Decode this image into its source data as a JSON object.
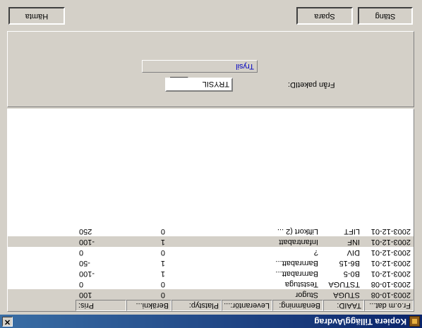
{
  "window": {
    "title": "Kopiera Tillägg\\Avdrag",
    "close_glyph": "✕"
  },
  "grid": {
    "columns": [
      {
        "label": "Fr.o.m dat...",
        "align": "left"
      },
      {
        "label": "TAAID:",
        "align": "left"
      },
      {
        "label": "Benämning:",
        "align": "left"
      },
      {
        "label": "Leverantör:...",
        "align": "left"
      },
      {
        "label": "Platstyp:",
        "align": "left"
      },
      {
        "label": "Beräkni...",
        "align": "left"
      },
      {
        "label": "Pris:",
        "align": "right"
      }
    ],
    "rows": [
      {
        "date": "2003-10-08",
        "id": "STUGA",
        "name": "Stugor",
        "calc": "0",
        "price": "100",
        "highlight": true
      },
      {
        "date": "2003-10-08",
        "id": "TSTUGA",
        "name": "Teststuga",
        "calc": "0",
        "price": "0",
        "highlight": false
      },
      {
        "date": "2003-12-01",
        "id": "B0-5",
        "name": "Barnrabatt...",
        "calc": "1",
        "price": "-100",
        "highlight": false
      },
      {
        "date": "2003-12-01",
        "id": "B6-15",
        "name": "Barnrabatt...",
        "calc": "1",
        "price": "-50",
        "highlight": false
      },
      {
        "date": "2003-12-01",
        "id": "DIV",
        "name": "?",
        "calc": "0",
        "price": "0",
        "highlight": false
      },
      {
        "date": "2003-12-01",
        "id": "INF",
        "name": "Infantrabatt",
        "calc": "1",
        "price": "-100",
        "highlight": true
      },
      {
        "date": "2003-12-01",
        "id": "LIFT",
        "name": "Liftkort (2 ...",
        "calc": "0",
        "price": "250",
        "highlight": false
      }
    ]
  },
  "package": {
    "label": "Från paketID:",
    "value": "TRYSIL",
    "name": "Trysil",
    "search_icon": "binoculars-icon"
  },
  "buttons": {
    "fetch": "Hämta",
    "save": "Spara",
    "close": "Stäng"
  }
}
